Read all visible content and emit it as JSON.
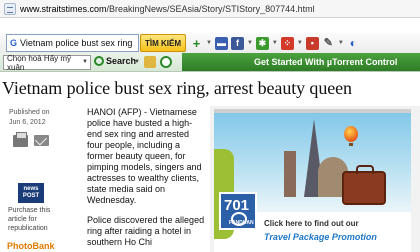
{
  "browser": {
    "url_host": "www.straitstimes.com",
    "url_path": "/BreakingNews/SEAsia/Story/STIStory_807744.html"
  },
  "toolbar": {
    "search_value": "Vietnam police bust sex ring",
    "find_button": "TÌM KIẾM",
    "icons": [
      "plus-icon",
      "bar-icon",
      "facebook-icon",
      "green-icon",
      "dice-icon",
      "square-icon",
      "pen-icon",
      "blue-icon"
    ]
  },
  "toolbar2": {
    "language": "Chọn hoà Hãy mỹ xuân",
    "search_label": "Search",
    "banner_text": "Get Started With µTorrent Control"
  },
  "article": {
    "headline": "Vietnam police bust sex ring, arrest beauty queen",
    "published_label": "Published on",
    "published_date": "Jun 6, 2012",
    "paragraph1": "HANOI (AFP) - Vietnamese police have busted a high-end sex ring and arrested four people, including a former beauty queen, for pimping models, singers and actresses to wealthy clients, state media said on Wednesday.",
    "paragraph2": "Police discovered the alleged ring after raiding a hotel in southern Ho Chi",
    "newspost_label": "news POST",
    "purchase_text": "Purchase this article for republication",
    "photobank": "PhotoBank"
  },
  "ad": {
    "brand": "701",
    "brand_sub": "PANDUAN",
    "text1": "Click here to find out our",
    "text2": "Travel Package Promotion"
  },
  "colors": {
    "banner": "#3a8f30",
    "ad_link": "#1f78c8",
    "photobank": "#e07b00"
  }
}
